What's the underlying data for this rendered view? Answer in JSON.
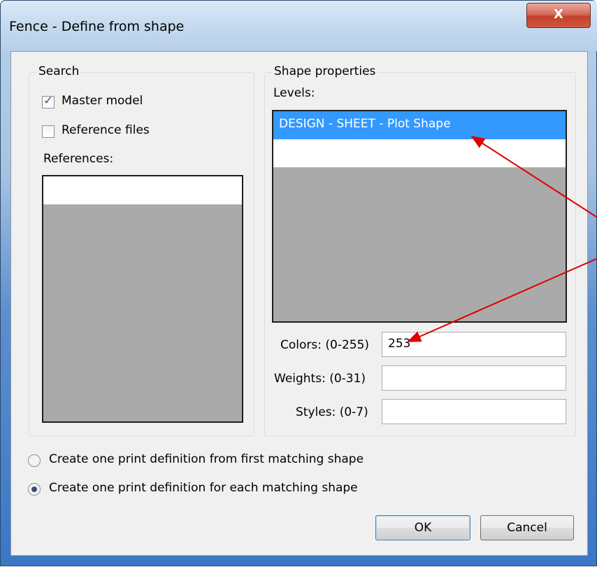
{
  "window": {
    "title": "Fence - Define from shape",
    "close_label": "X"
  },
  "search": {
    "legend": "Search",
    "master_model": {
      "label": "Master model",
      "checked": true
    },
    "reference_files": {
      "label": "Reference files",
      "checked": false
    },
    "references_label": "References:"
  },
  "shape_properties": {
    "legend": "Shape properties",
    "levels_label": "Levels:",
    "levels_items": [
      "DESIGN - SHEET - Plot Shape",
      ""
    ],
    "selected_level": "DESIGN - SHEET - Plot Shape",
    "colors": {
      "label": "Colors: (0-255)",
      "value": "253"
    },
    "weights": {
      "label": "Weights: (0-31)",
      "value": ""
    },
    "styles": {
      "label": "Styles: (0-7)",
      "value": ""
    }
  },
  "options": {
    "first_match": {
      "label": "Create one print definition from first matching shape",
      "selected": false
    },
    "each_match": {
      "label": "Create one print definition for each matching shape",
      "selected": true
    }
  },
  "buttons": {
    "ok": "OK",
    "cancel": "Cancel"
  },
  "colors": {
    "annotation_arrow": "#e00000",
    "selection": "#3399ff"
  }
}
